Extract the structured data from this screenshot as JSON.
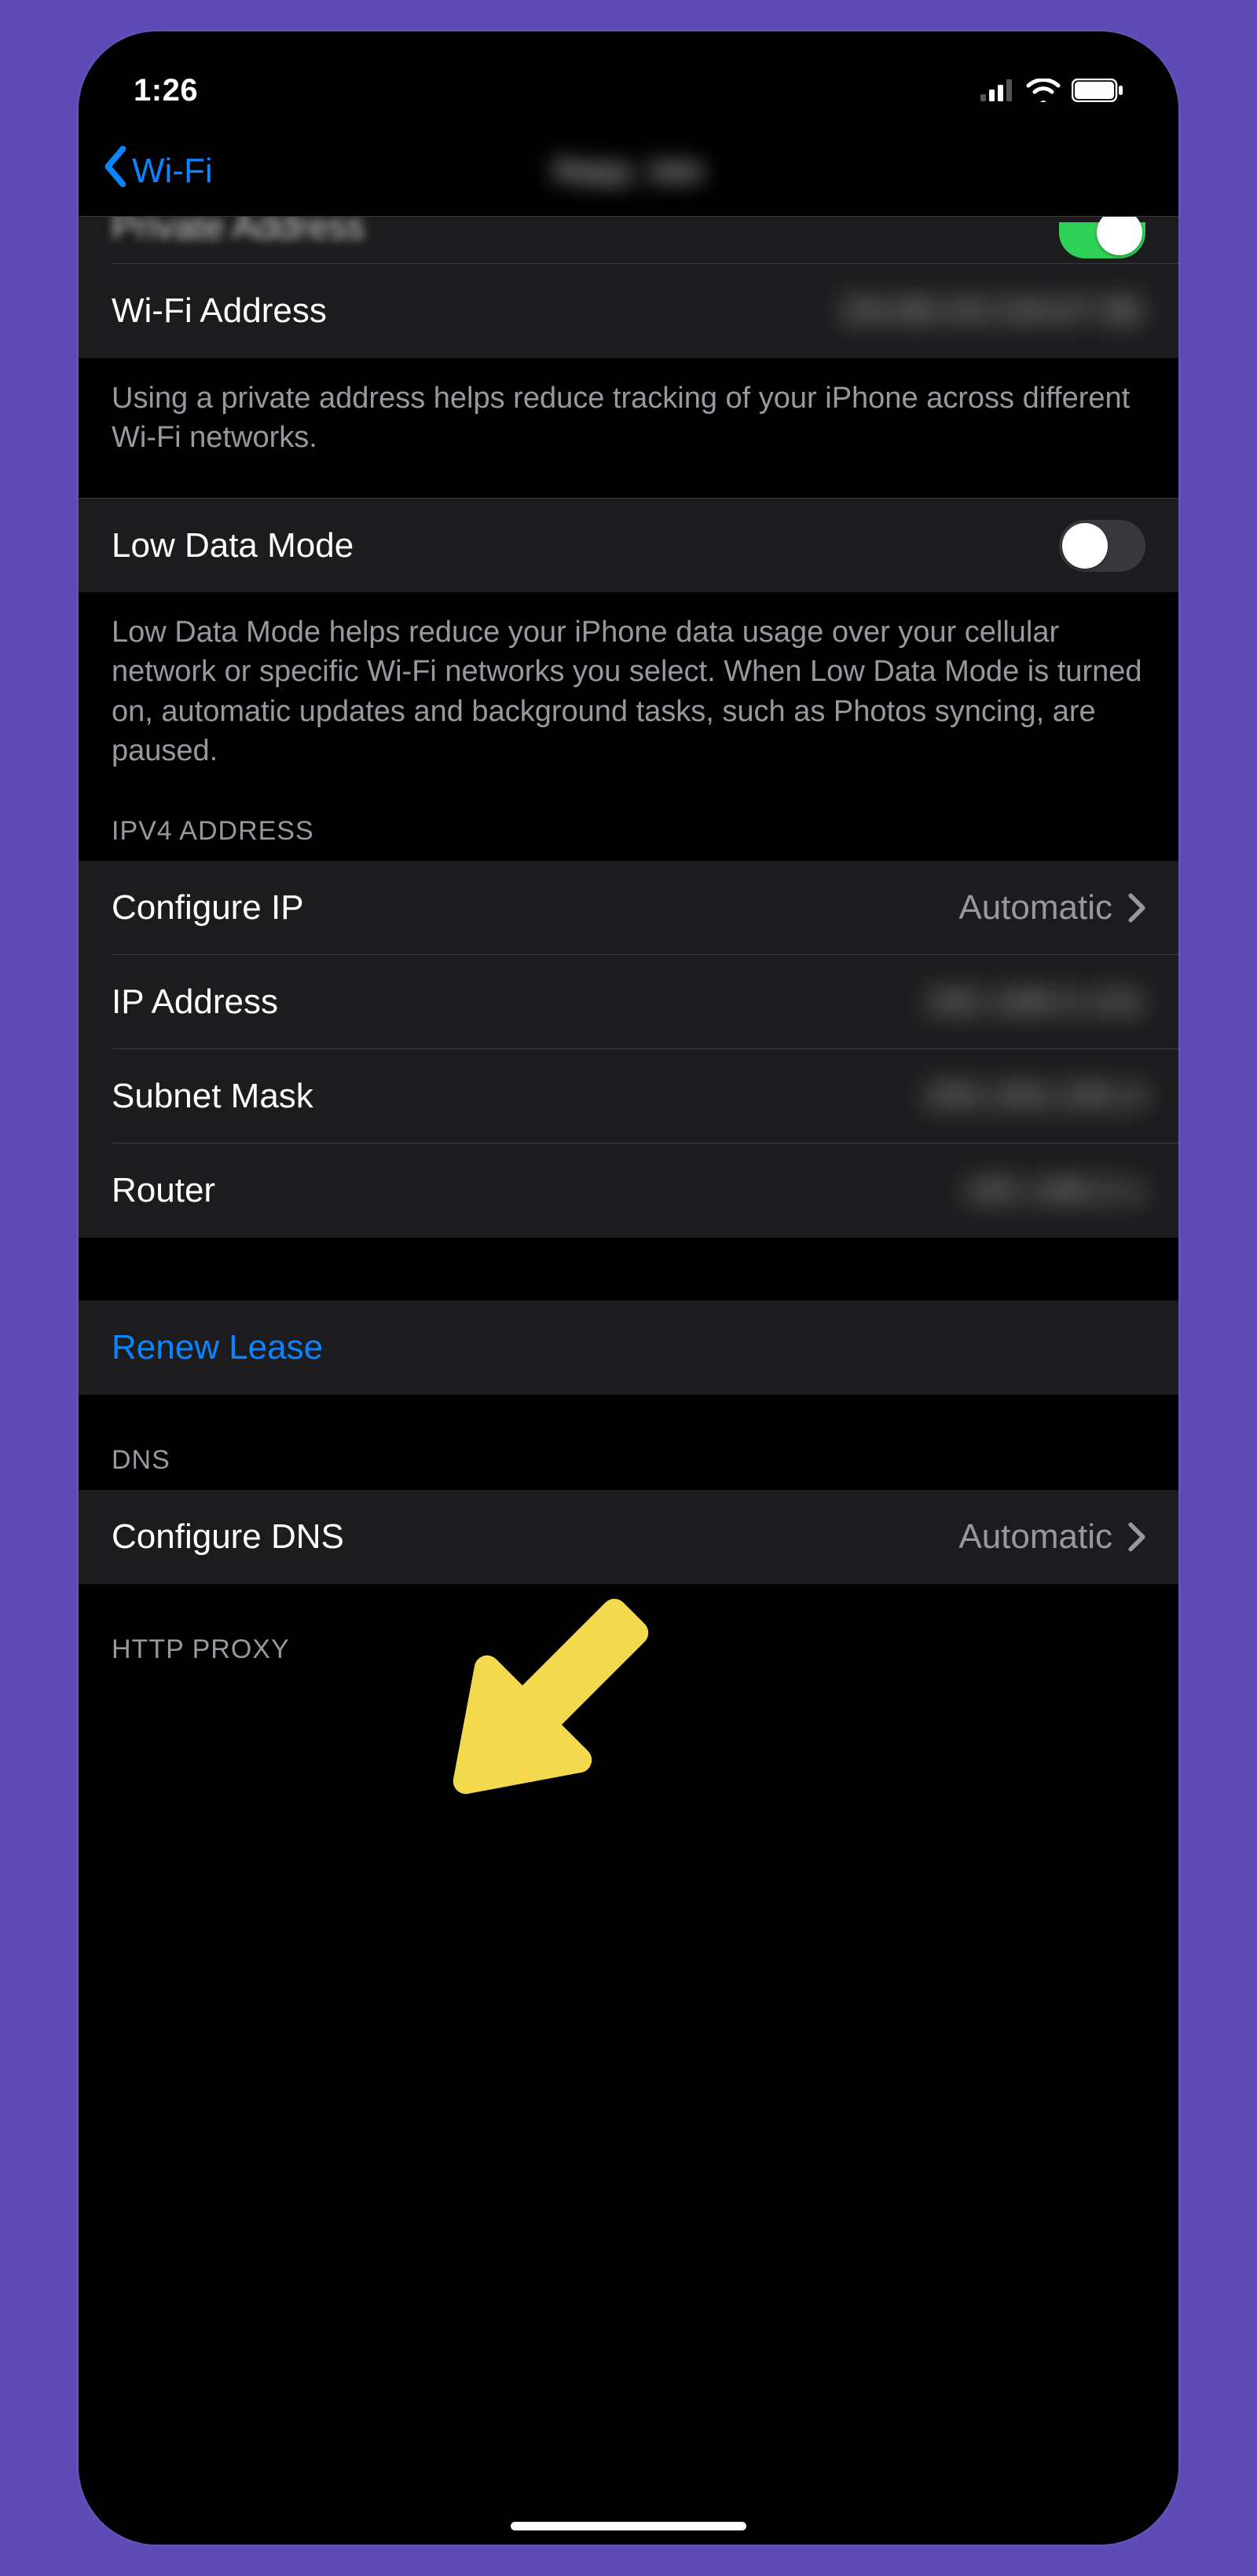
{
  "status_bar": {
    "time": "1:26"
  },
  "nav": {
    "back_label": "Wi-Fi",
    "title_blurred": "Napp_late"
  },
  "rows": {
    "private_address": {
      "label": "Private Address",
      "toggle_on": true
    },
    "wifi_address": {
      "label": "Wi-Fi Address",
      "value_blurred": "D6:88:AD:D8:87:8E"
    },
    "private_address_footer": "Using a private address helps reduce tracking of your iPhone across different Wi-Fi networks.",
    "low_data_mode": {
      "label": "Low Data Mode",
      "toggle_on": false
    },
    "low_data_mode_footer": "Low Data Mode helps reduce your iPhone data usage over your cellular network or specific Wi-Fi networks you select. When Low Data Mode is turned on, automatic updates and background tasks, such as Photos syncing, are paused.",
    "ipv4_header": "IPV4 ADDRESS",
    "configure_ip": {
      "label": "Configure IP",
      "value": "Automatic"
    },
    "ip_address": {
      "label": "IP Address",
      "value_blurred": "192.168.0.101"
    },
    "subnet_mask": {
      "label": "Subnet Mask",
      "value_blurred": "255.255.255.0"
    },
    "router": {
      "label": "Router",
      "value_blurred": "192.168.0.1"
    },
    "renew_lease": {
      "label": "Renew Lease"
    },
    "dns_header": "DNS",
    "configure_dns": {
      "label": "Configure DNS",
      "value": "Automatic"
    },
    "http_proxy_header": "HTTP PROXY"
  },
  "colors": {
    "accent_blue": "#0a84ff",
    "toggle_on": "#30d158",
    "arrow_yellow": "#f2d94e",
    "background_purple": "#5f4bb6"
  }
}
